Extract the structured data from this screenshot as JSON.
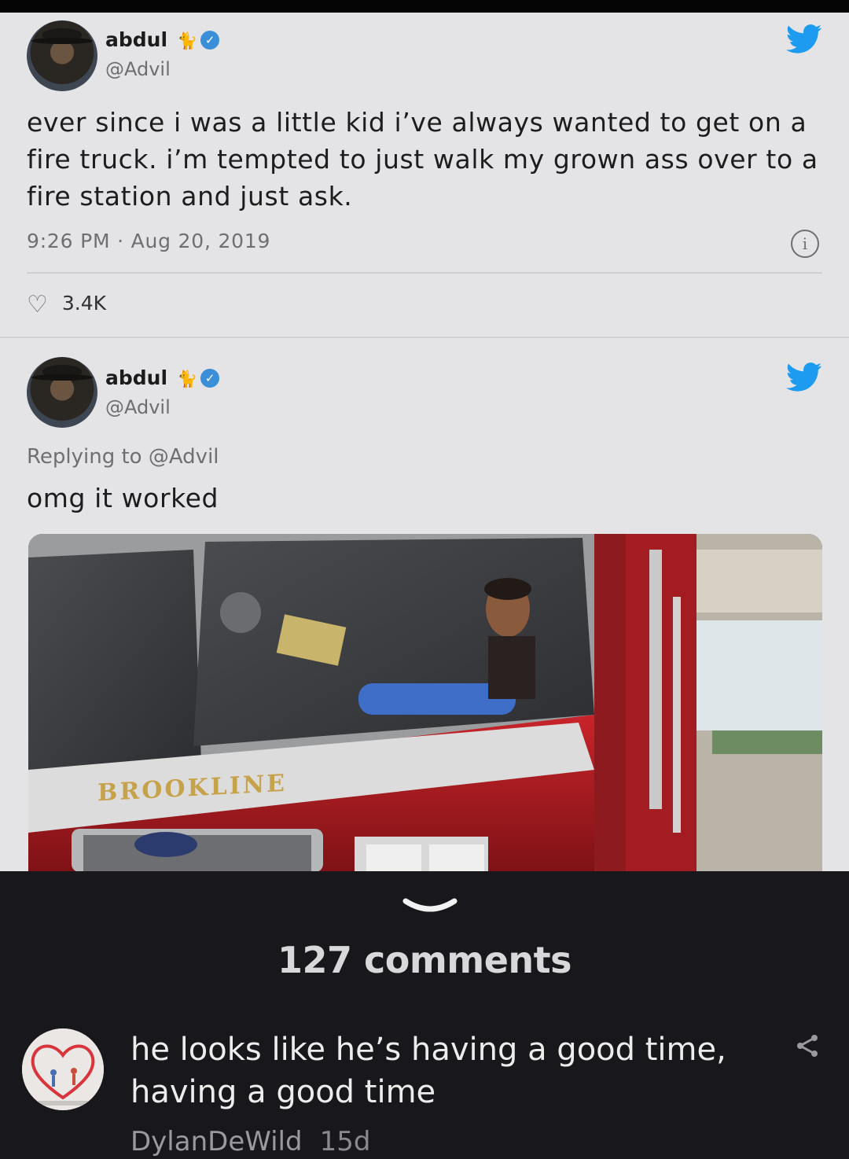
{
  "tweet1": {
    "name": "abdul",
    "badge_emoji": "🐈‍⬛",
    "handle": "@Advil",
    "text": "ever since i was a little kid i’ve always wanted to get on a fire truck. i’m tempted to just walk my grown ass over to a fire station and just ask.",
    "timestamp": "9:26 PM · Aug 20, 2019",
    "likes": "3.4K",
    "info_icon": "info-icon"
  },
  "tweet2": {
    "name": "abdul",
    "badge_emoji": "🐈‍⬛",
    "handle": "@Advil",
    "replying_to": "Replying to @Advil",
    "text": "omg it worked",
    "photo_truck_label": "BROOKLINE"
  },
  "comments": {
    "title": "127 comments",
    "first": {
      "text": "he looks like he’s having a good time, having a good time",
      "user": "DylanDeWild",
      "age": "15d"
    }
  },
  "colors": {
    "twitter_blue": "#1d9bf0",
    "verified_blue": "#3a8fd8",
    "sheet_bg": "#e4e4e6",
    "dark_bg": "#18181c"
  }
}
